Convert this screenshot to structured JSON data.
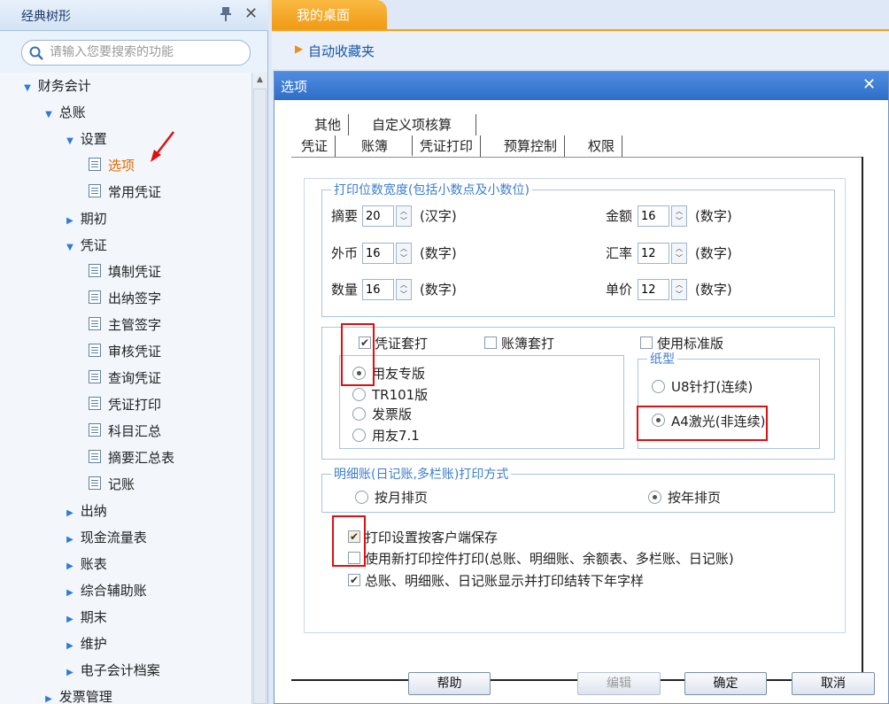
{
  "left_panel": {
    "title": "经典树形",
    "search_placeholder": "请输入您要搜索的功能",
    "tree": {
      "finance": "财务会计",
      "gl": "总账",
      "settings": "设置",
      "options": "选项",
      "common_voucher": "常用凭证",
      "opening": "期初",
      "voucher": "凭证",
      "fill_voucher": "填制凭证",
      "cashier_sign": "出纳签字",
      "supervisor_sign": "主管签字",
      "audit_voucher": "审核凭证",
      "query_voucher": "查询凭证",
      "print_voucher": "凭证打印",
      "account_summary": "科目汇总",
      "summary_table": "摘要汇总表",
      "bookkeeping": "记账",
      "cashier": "出纳",
      "cashflow": "现金流量表",
      "ledgers": "账表",
      "aux": "综合辅助账",
      "period_end": "期末",
      "maintenance": "维护",
      "e_archive": "电子会计档案",
      "invoice_mgmt": "发票管理"
    }
  },
  "top": {
    "tab_label": "我的桌面",
    "favorites_label": "自动收藏夹"
  },
  "dialog": {
    "title": "选项",
    "tabs_row1": [
      "其他",
      "自定义项核算"
    ],
    "tabs_row2": [
      "凭证",
      "账簿",
      "凭证打印",
      "预算控制",
      "权限"
    ],
    "print_width": {
      "label": "打印位数宽度(包括小数点及小数位)",
      "fields": {
        "summary": {
          "label": "摘要",
          "value": "20",
          "unit": "(汉字)"
        },
        "amount": {
          "label": "金额",
          "value": "16",
          "unit": "(数字)"
        },
        "foreign": {
          "label": "外币",
          "value": "16",
          "unit": "(数字)"
        },
        "rate": {
          "label": "汇率",
          "value": "12",
          "unit": "(数字)"
        },
        "quantity": {
          "label": "数量",
          "value": "16",
          "unit": "(数字)"
        },
        "price": {
          "label": "单价",
          "value": "12",
          "unit": "(数字)"
        }
      }
    },
    "print_mode": {
      "voucher_print": {
        "label": "凭证套打",
        "checked": true
      },
      "ledger_print": {
        "label": "账簿套打",
        "checked": false
      },
      "standard_edition": {
        "label": "使用标准版",
        "checked": false
      },
      "versions": [
        {
          "label": "用友专版",
          "selected": true
        },
        {
          "label": "TR101版",
          "selected": false
        },
        {
          "label": "发票版",
          "selected": false
        },
        {
          "label": "用友7.1",
          "selected": false
        }
      ],
      "paper": {
        "label": "纸型",
        "options": [
          {
            "label": "U8针打(连续)",
            "selected": false
          },
          {
            "label": "A4激光(非连续)",
            "selected": true
          }
        ]
      }
    },
    "detail_print": {
      "label": "明细账(日记账,多栏账)打印方式",
      "by_month": {
        "label": "按月排页",
        "selected": false
      },
      "by_year": {
        "label": "按年排页",
        "selected": true
      }
    },
    "checks": [
      {
        "label": "打印设置按客户端保存",
        "checked": true
      },
      {
        "label": "使用新打印控件打印(总账、明细账、余额表、多栏账、日记账)",
        "checked": false
      },
      {
        "label": "总账、明细账、日记账显示并打印结转下年字样",
        "checked": true
      }
    ],
    "buttons": {
      "help": "帮助",
      "edit": "编辑",
      "ok": "确定",
      "cancel": "取消"
    }
  },
  "colors": {
    "accent_orange": "#f19b16",
    "title_blue": "#2f6ec7",
    "highlight_red": "#e01010",
    "active_item": "#e06a00"
  }
}
